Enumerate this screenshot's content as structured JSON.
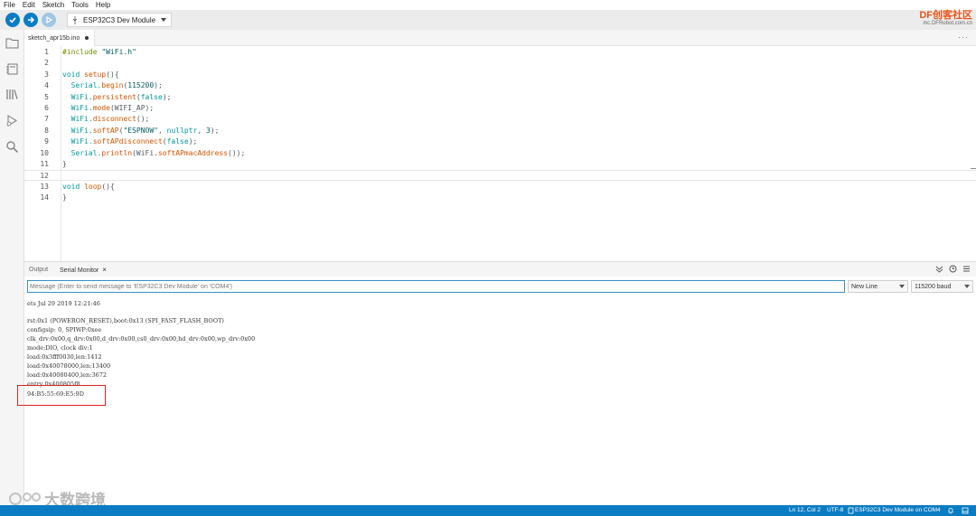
{
  "menu": [
    "File",
    "Edit",
    "Sketch",
    "Tools",
    "Help"
  ],
  "toolbar": {
    "board": "ESP32C3 Dev Module"
  },
  "brand": {
    "name": "DF创客社区",
    "url": "mc.DFRobot.com.cn"
  },
  "tab": {
    "filename": "sketch_apr15b.ino"
  },
  "editor": {
    "lines": [
      "1",
      "2",
      "3",
      "4",
      "5",
      "6",
      "7",
      "8",
      "9",
      "10",
      "11",
      "12",
      "13",
      "14"
    ],
    "code": {
      "l1a": "#include ",
      "l1b": "\"WiFi.h\"",
      "l3a": "void ",
      "l3b": "setup",
      "l3c": "(){",
      "l4a": "  Serial.",
      "l4b": "begin",
      "l4c": "(",
      "l4d": "115200",
      "l4e": ");",
      "l5a": "  WiFi.",
      "l5b": "persistent",
      "l5c": "(",
      "l5d": "false",
      "l5e": ");",
      "l6a": "  WiFi.",
      "l6b": "mode",
      "l6c": "(WIFI_AP);",
      "l7a": "  WiFi.",
      "l7b": "disconnect",
      "l7c": "();",
      "l8a": "  WiFi.",
      "l8b": "softAP",
      "l8c": "(",
      "l8d": "\"ESPNOW\"",
      "l8e": ", ",
      "l8f": "nullptr",
      "l8g": ", ",
      "l8h": "3",
      "l8i": ");",
      "l9a": "  WiFi.",
      "l9b": "softAPdisconnect",
      "l9c": "(",
      "l9d": "false",
      "l9e": ");",
      "l10a": "  Serial.",
      "l10b": "println",
      "l10c": "(WiFi.",
      "l10d": "softAPmacAddress",
      "l10e": "());",
      "l11": "}",
      "l13a": "void ",
      "l13b": "loop",
      "l13c": "(){",
      "l14": "}"
    }
  },
  "output": {
    "tab_output": "Output",
    "tab_serial": "Serial Monitor",
    "close": "×"
  },
  "serial": {
    "placeholder": "Message (Enter to send message to 'ESP32C3 Dev Module' on 'COM4')",
    "line_ending": "New Line",
    "baud": "115200 baud",
    "lines": [
      "ets Jul 29 2019 12:21:46",
      "",
      "rst:0x1 (POWERON_RESET),boot:0x13 (SPI_FAST_FLASH_BOOT)",
      "configsip: 0, SPIWP:0xee",
      "clk_drv:0x00,q_drv:0x00,d_drv:0x00,cs0_drv:0x00,hd_drv:0x00,wp_drv:0x00",
      "mode:DIO, clock div:1",
      "load:0x3fff0030,len:1412",
      "load:0x40078000,len:13400",
      "load:0x40080400,len:3672",
      "entry 0x400805f8",
      "94:B5:55:69:E5:9D"
    ]
  },
  "watermark": "大数跨境",
  "status": {
    "position": "Ln 12, Col 2",
    "encoding": "UTF-8",
    "board_port": "ESP32C3 Dev Module on COM4"
  },
  "colors": {
    "accent": "#0a7cc4",
    "highlight": "#e02020"
  }
}
